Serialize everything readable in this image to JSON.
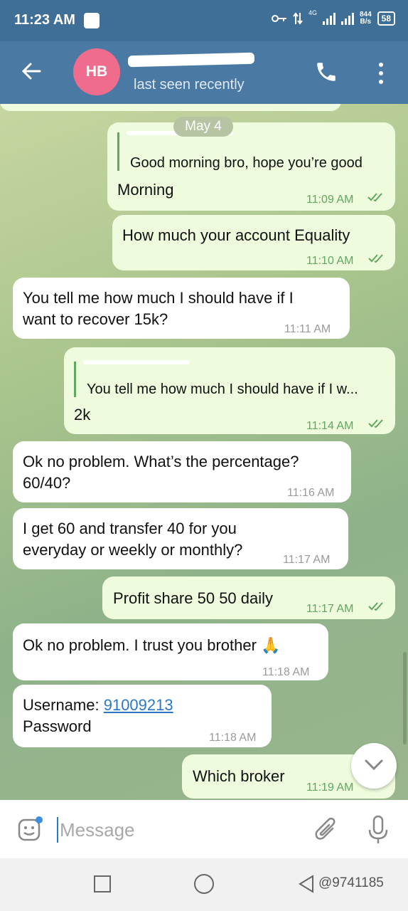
{
  "status_bar": {
    "time": "11:23 AM",
    "network": "4G",
    "speed": "844",
    "speed_unit": "B/s",
    "battery": "58"
  },
  "header": {
    "avatar_initials": "HB",
    "status": "last seen recently",
    "back_icon": "arrow-left-icon",
    "call_icon": "phone-icon",
    "more_icon": "more-vertical-icon"
  },
  "chat": {
    "date_separator": "May 4",
    "messages": [
      {
        "dir": "out",
        "quote": "Good morning bro, hope you’re good",
        "text": "Morning",
        "time": "11:09 AM",
        "read": true
      },
      {
        "dir": "out",
        "text": "How much your account Equality",
        "time": "11:10 AM",
        "read": true
      },
      {
        "dir": "in",
        "lines": [
          "You tell me how much I should have if I",
          "want to recover 15k?"
        ],
        "time": "11:11 AM"
      },
      {
        "dir": "out",
        "quote": "You tell me how much I should have if I w...",
        "text": "2k",
        "time": "11:14 AM",
        "read": true
      },
      {
        "dir": "in",
        "lines": [
          "Ok no problem. What’s the percentage?",
          "60/40?"
        ],
        "time": "11:16 AM"
      },
      {
        "dir": "in",
        "lines": [
          "I get 60 and transfer 40 for you",
          "everyday or weekly or monthly?"
        ],
        "time": "11:17 AM"
      },
      {
        "dir": "out",
        "text": "Profit share 50 50 daily",
        "time": "11:17 AM",
        "read": true
      },
      {
        "dir": "in",
        "text": "Ok no problem. I trust you brother 🙏",
        "time": "11:18 AM"
      },
      {
        "dir": "in",
        "username_label": "Username: ",
        "username_value": "91009213",
        "password_label": "Password",
        "time": "11:18 AM"
      },
      {
        "dir": "out",
        "text": "Which broker",
        "time": "11:19 AM",
        "read": true
      }
    ]
  },
  "input": {
    "placeholder": "Message",
    "emoji_icon": "sticker-emoji-icon",
    "attach_icon": "paperclip-icon",
    "mic_icon": "microphone-icon"
  },
  "nav": {
    "watermark": "@9741185"
  },
  "colors": {
    "header": "#4a7aa3",
    "avatar": "#ef6c8c",
    "outgoing_bubble": "#eefbdc",
    "incoming_bubble": "#ffffff",
    "read_tick": "#5fa760",
    "link": "#2a78c6"
  }
}
